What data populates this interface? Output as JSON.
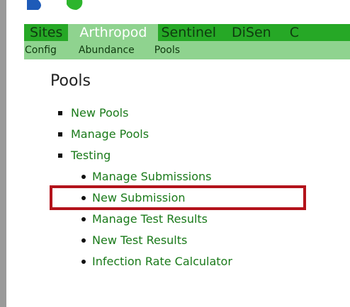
{
  "top_nav": {
    "items": [
      {
        "label": "Sites",
        "active": false
      },
      {
        "label": "Arthropod",
        "active": true
      },
      {
        "label": "Sentinel",
        "active": false
      },
      {
        "label": "DiSen",
        "active": false
      },
      {
        "label": "C",
        "active": false
      }
    ]
  },
  "sub_nav": {
    "items": [
      {
        "label": "Config"
      },
      {
        "label": "Abundance"
      },
      {
        "label": "Pools"
      }
    ]
  },
  "page": {
    "title": "Pools"
  },
  "menu": {
    "new_pools": "New Pools",
    "manage_pools": "Manage Pools",
    "testing": "Testing",
    "testing_items": [
      {
        "label": "Manage Submissions"
      },
      {
        "label": "New Submission"
      },
      {
        "label": "Manage Test Results"
      },
      {
        "label": "New Test Results"
      },
      {
        "label": "Infection Rate Calculator"
      }
    ]
  },
  "colors": {
    "nav_green": "#26a826",
    "subnav_green": "#8fd38f",
    "link_green": "#1a7a1a",
    "highlight_red": "#b3131b",
    "logo_blue": "#1e5bb8",
    "logo_green": "#2db52d"
  },
  "icons": {
    "logo": "logo-icon",
    "top_level_bullet": "square-bullet-icon",
    "sub_level_bullet": "dot-bullet-icon"
  }
}
